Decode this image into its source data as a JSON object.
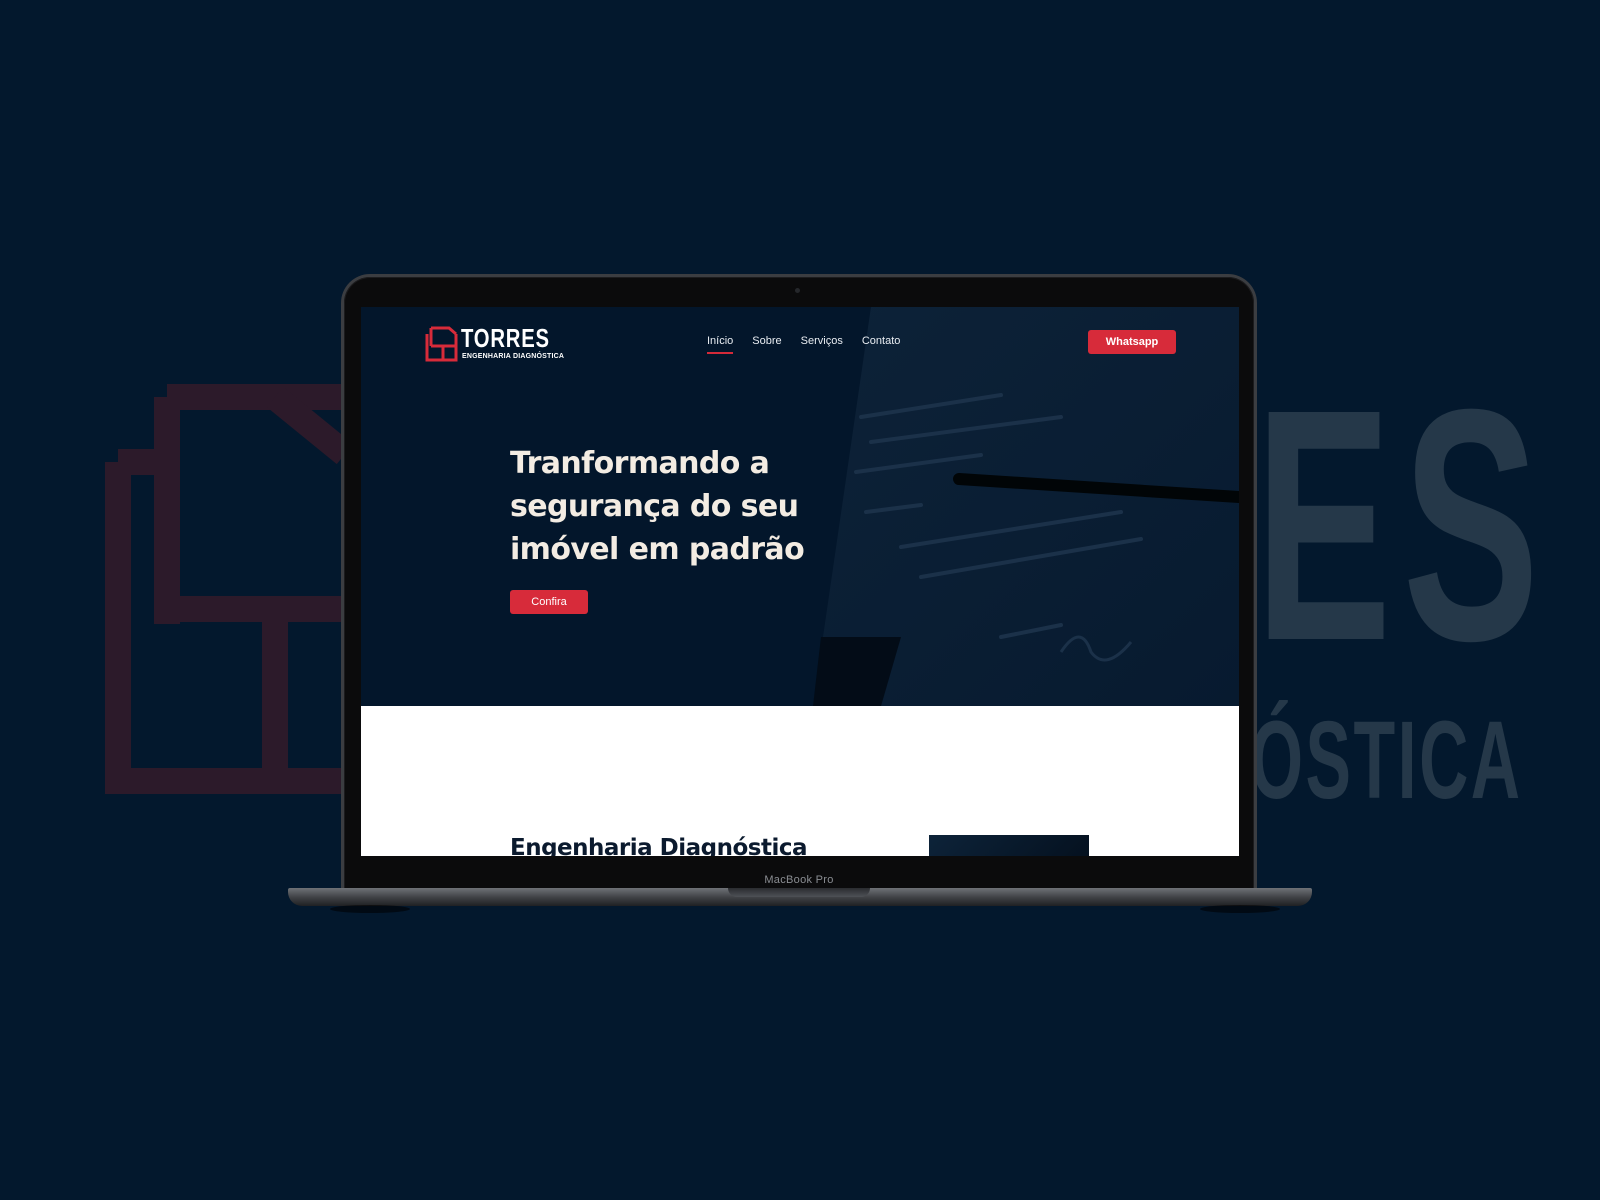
{
  "background": {
    "wordmark": "ES",
    "tagline": "ÓSTICA",
    "color": "#03182d"
  },
  "device": {
    "model_label": "MacBook Pro"
  },
  "site": {
    "brand": {
      "name": "TORRES",
      "subtitle": "ENGENHARIA DIAGNÓSTICA",
      "accent": "#d72b3a"
    },
    "nav": {
      "items": [
        {
          "label": "Início",
          "active": true
        },
        {
          "label": "Sobre",
          "active": false
        },
        {
          "label": "Serviços",
          "active": false
        },
        {
          "label": "Contato",
          "active": false
        }
      ],
      "cta_label": "Whatsapp"
    },
    "hero": {
      "title": "Tranformando a segurança do seu imóvel em padrão",
      "button_label": "Confira",
      "background": "#03162b"
    },
    "section": {
      "title": "Engenharia Diagnóstica"
    }
  }
}
